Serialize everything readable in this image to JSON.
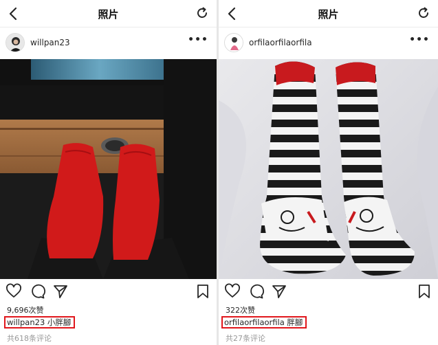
{
  "left": {
    "header_title": "照片",
    "username": "willpan23",
    "likes": "9,696次赞",
    "caption_user": "willpan23",
    "caption_text": "小胖腳",
    "comments": "共618条评论"
  },
  "right": {
    "header_title": "照片",
    "username": "orfilaorfilaorfila",
    "likes": "322次赞",
    "caption_user": "orfilaorfilaorfila",
    "caption_text": "胖腳",
    "comments": "共27条评论"
  },
  "icons": {
    "back": "chevron-left-icon",
    "refresh": "refresh-icon",
    "more": "more-dots-icon",
    "like": "heart-icon",
    "comment": "comment-icon",
    "share": "send-icon",
    "save": "bookmark-icon"
  },
  "colors": {
    "highlight": "#e0161b",
    "sock_red": "#d11a1a",
    "text": "#262626",
    "muted": "#999999"
  }
}
